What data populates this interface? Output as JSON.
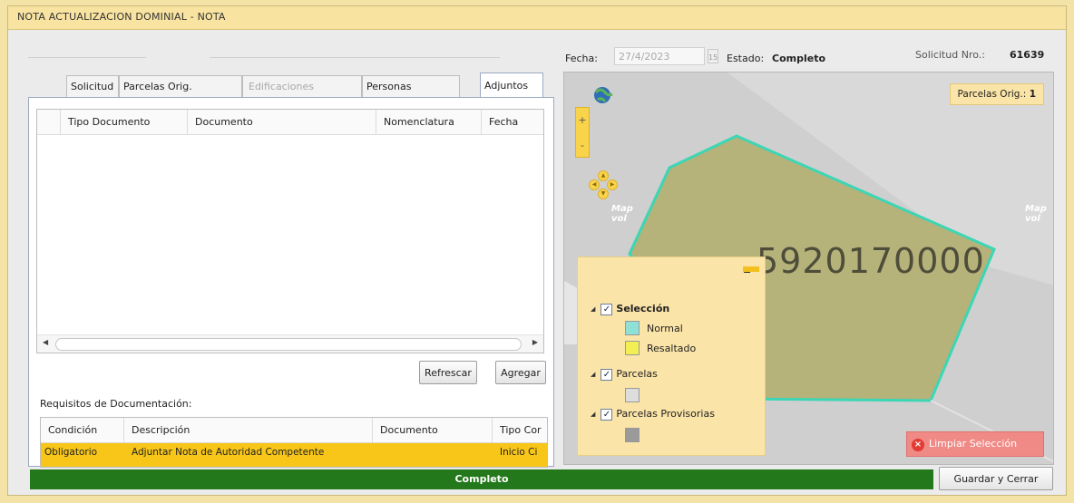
{
  "window": {
    "title": "NOTA ACTUALIZACION DOMINIAL  -  NOTA"
  },
  "header": {
    "fecha_label": "Fecha:",
    "fecha_value": "27/4/2023",
    "calendar_day": "15",
    "estado_label": "Estado:",
    "estado_value": "Completo",
    "solicitud_label": "Solicitud Nro.:",
    "solicitud_value": "61639"
  },
  "tabs": [
    {
      "label": "Solicitud",
      "state": "normal"
    },
    {
      "label": "Parcelas Orig.",
      "state": "normal"
    },
    {
      "label": "Edificaciones",
      "state": "disabled"
    },
    {
      "label": "Personas",
      "state": "normal"
    },
    {
      "label": "Adjuntos",
      "state": "active"
    }
  ],
  "adjuntos_grid": {
    "columns": [
      "",
      "Tipo Documento",
      "Documento",
      "Nomenclatura",
      "Fecha"
    ],
    "rows": []
  },
  "buttons": {
    "refrescar": "Refrescar",
    "agregar": "Agregar",
    "guardar_cerrar": "Guardar y Cerrar"
  },
  "requisitos": {
    "label": "Requisitos de Documentación:",
    "columns": [
      "Condición",
      "Descripción",
      "Documento",
      "Tipo Cor"
    ],
    "rows": [
      {
        "condicion": "Obligatorio",
        "descripcion": "Adjuntar Nota de Autoridad Competente",
        "documento": "",
        "tipo": "Inicio Ci"
      }
    ]
  },
  "status_bar": {
    "text": "Completo",
    "color": "#23781b"
  },
  "map": {
    "badge_label": "Parcelas Orig.:",
    "badge_value": "1",
    "parcel_label": "5920170000",
    "side_label_left": "Map\nvol",
    "side_label_right": "Map\nvol",
    "zoom_in": "+",
    "zoom_out": "-",
    "parcel_fill": "#b5b27a",
    "parcel_stroke": "#3cd6b5",
    "legend": {
      "collapse": "−",
      "layers": [
        {
          "label": "Selección",
          "checked": true,
          "bold": true,
          "items": [
            {
              "label": "Normal",
              "color": "#8fe0d6"
            },
            {
              "label": "Resaltado",
              "color": "#f3ef52"
            }
          ]
        },
        {
          "label": "Parcelas",
          "checked": true,
          "bold": false,
          "items": [
            {
              "label": "",
              "color": "#dddddd"
            }
          ]
        },
        {
          "label": "Parcelas Provisorias",
          "checked": true,
          "bold": false,
          "items": [
            {
              "label": "",
              "color": "#9a9a9a"
            }
          ]
        }
      ]
    },
    "clear_button": "Limpiar Selección"
  }
}
